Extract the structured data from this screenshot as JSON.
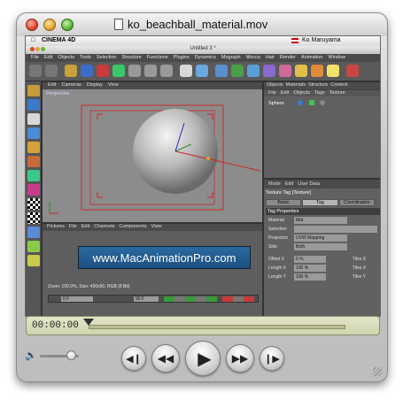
{
  "window": {
    "title": "ko_beachball_material.mov"
  },
  "mac_menubar": {
    "app_name": "CINEMA 4D",
    "user_name": "Ko Maruyama"
  },
  "c4d_window": {
    "title": "Untitled 3 *"
  },
  "c4d_menu": [
    "File",
    "Edit",
    "Objects",
    "Tools",
    "Selection",
    "Structure",
    "Functions",
    "Plugins",
    "Dynamics",
    "Mograph",
    "Mocca",
    "Hair",
    "Render",
    "Animation",
    "Window"
  ],
  "viewport": {
    "menu": [
      "Edit",
      "Cameras",
      "Display",
      "View"
    ],
    "label": "Perspective"
  },
  "object_manager": {
    "tabs": [
      "Objects",
      "Materials",
      "Structure",
      "Content"
    ],
    "menu": [
      "File",
      "Edit",
      "Objects",
      "Tags",
      "Texture"
    ],
    "object_name": "Sphere"
  },
  "attributes": {
    "menu": [
      "Mode",
      "Edit",
      "User Data"
    ],
    "tag_title": "Texture Tag [Texture]",
    "tabs": [
      "Basic",
      "Tag",
      "Coordinates"
    ],
    "section": "Tag Properties",
    "fields": [
      {
        "label": "Material",
        "value": "Mat"
      },
      {
        "label": "Selection",
        "value": ""
      },
      {
        "label": "Projection",
        "value": "UVW Mapping"
      },
      {
        "label": "Side",
        "value": "Both"
      },
      {
        "label": "Offset X",
        "value": "0 %"
      },
      {
        "label": "Length X",
        "value": "100 %"
      },
      {
        "label": "Length Y",
        "value": "100 %"
      }
    ],
    "tiles_x_label": "Tiles X",
    "tiles_y_label": "Tiles Y"
  },
  "pictures": {
    "menu": [
      "Pictures",
      "File",
      "Edit",
      "Channels",
      "Components",
      "View"
    ],
    "watermark": "www.MacAnimationPro.com",
    "info": "Zoom: 100.0%, Size: 400x50, RGB (8 Bit)",
    "frame_start": "0 F",
    "frame_end": "90 F"
  },
  "player": {
    "timecode": "00:00:00",
    "position_fraction": 0.0,
    "volume_fraction": 0.8,
    "icons": {
      "volume": "speaker-icon",
      "start": "skip-to-start-icon",
      "rewind": "rewind-icon",
      "play": "play-icon",
      "fast_forward": "fast-forward-icon",
      "end": "skip-to-end-icon"
    }
  },
  "colors": {
    "accent_lcd": "#d4d8b4",
    "banner": "#2a6aa0",
    "close": "#e0442e",
    "minimize": "#e9a32b",
    "zoom": "#5cb83a"
  }
}
